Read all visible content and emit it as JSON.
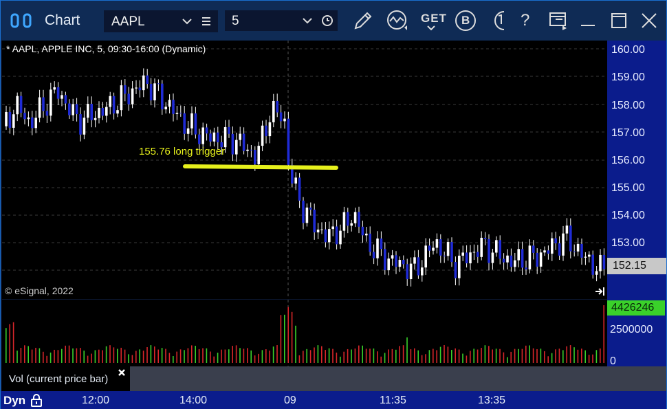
{
  "window": {
    "title": "Chart",
    "symbol": "AAPL",
    "interval": "5",
    "toolbar_get_label": "GET",
    "toolbar_b_label": "B",
    "toolbar_help_label": "?"
  },
  "chart": {
    "header": "* AAPL, APPLE INC, 5, 09:30-16:00 (Dynamic)",
    "watermark": "© eSignal, 2022",
    "annotation": "155.76 long trigger",
    "y_axis_labels": [
      "160.00",
      "159.00",
      "158.00",
      "157.00",
      "156.00",
      "155.00",
      "154.00",
      "153.00"
    ],
    "current_price": "152.15",
    "vol_axis_labels": [
      "2500000",
      "0"
    ],
    "current_volume": "4426246",
    "time_labels": [
      "12:00",
      "14:00",
      "09",
      "11:35",
      "13:35"
    ],
    "study_label": "Vol (current price bar)",
    "dyn_label": "Dyn",
    "colors": {
      "up": "#ffffff",
      "down": "#1f2bd6",
      "annotation": "#e6f01c",
      "vol_up": "#3ad12a",
      "vol_down": "#d8262a"
    }
  }
}
